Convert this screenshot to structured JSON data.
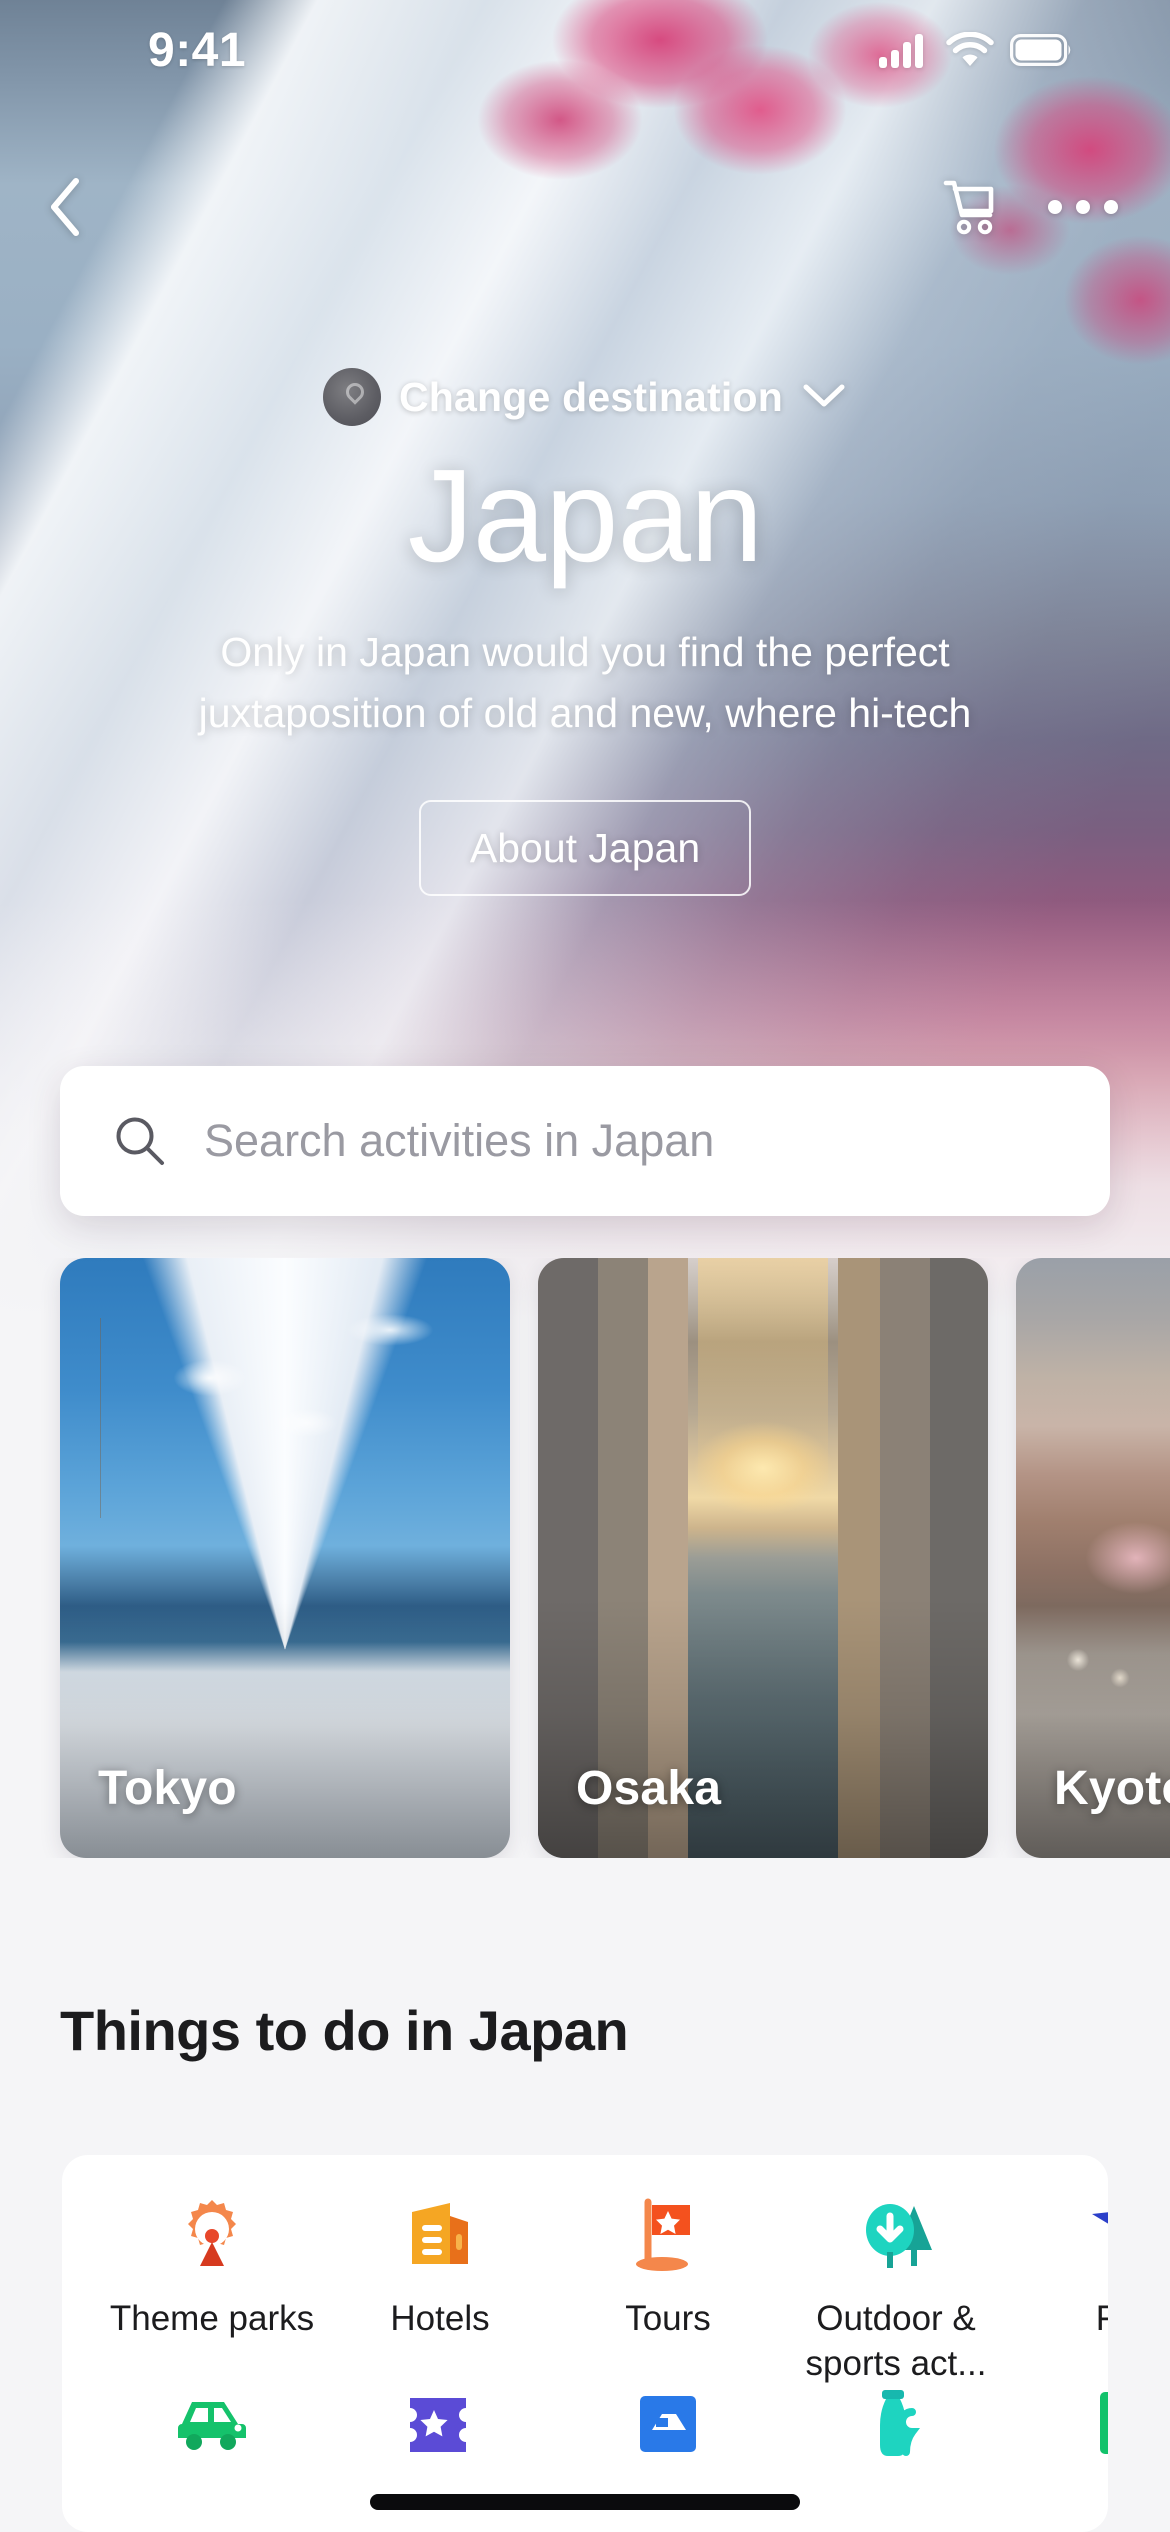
{
  "status_bar": {
    "time": "9:41",
    "signal_icon": "cellular-signal-icon",
    "wifi_icon": "wifi-icon",
    "battery_icon": "battery-icon"
  },
  "nav": {
    "back_icon": "chevron-left-icon",
    "cart_icon": "shopping-cart-icon",
    "more_icon": "more-options-icon"
  },
  "hero": {
    "destination_avatar": "location-pin-avatar",
    "change_destination_label": "Change destination",
    "chevron_icon": "chevron-down-icon",
    "title": "Japan",
    "description": "Only in Japan would you find the perfect juxtaposition of old and new, where hi-tech",
    "about_button_label": "About Japan"
  },
  "search": {
    "icon": "search-icon",
    "placeholder": "Search activities in Japan",
    "value": ""
  },
  "cities": [
    {
      "name": "Tokyo",
      "image": "mount-fuji-lake-snow"
    },
    {
      "name": "Osaka",
      "image": "dotonbori-canal-sunset"
    },
    {
      "name": "Kyoto",
      "image": "kyoto-street-sakura"
    }
  ],
  "things_to_do": {
    "title": "Things to do in Japan",
    "categories_row_1": [
      {
        "label": "Theme parks",
        "icon": "ferris-wheel-icon",
        "color": "#F4874B"
      },
      {
        "label": "Hotels",
        "icon": "hotel-building-icon",
        "color": "#F5A623"
      },
      {
        "label": "Tours",
        "icon": "flag-star-icon",
        "color": "#F4511E"
      },
      {
        "label": "Outdoor & sports act...",
        "icon": "trees-icon",
        "color": "#1ED4C0"
      },
      {
        "label": "Flig",
        "icon": "airplane-icon",
        "color": "#3355DD"
      }
    ],
    "categories_row_2": [
      {
        "label": "",
        "icon": "car-rental-icon",
        "color": "#15C26B"
      },
      {
        "label": "",
        "icon": "ticket-star-icon",
        "color": "#5B4BD6"
      },
      {
        "label": "",
        "icon": "transfer-card-icon",
        "color": "#2979E8"
      },
      {
        "label": "",
        "icon": "spa-bottle-icon",
        "color": "#1ED4C0"
      },
      {
        "label": "",
        "icon": "wifi-card-icon",
        "color": "#12C26B"
      }
    ]
  },
  "colors": {
    "page_background": "#f5f5f7",
    "card_background": "#ffffff",
    "text_primary": "#1c1c1e",
    "placeholder": "#9a9aa2"
  }
}
